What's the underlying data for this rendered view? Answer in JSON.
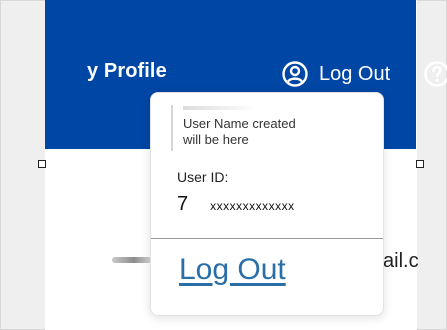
{
  "header": {
    "profile_label": "y Profile",
    "logout_label": "Log Out"
  },
  "background": {
    "email_fragment": "ail.c"
  },
  "dropdown": {
    "user_name_placeholder": "User Name created\nwill be here",
    "user_id_label": "User ID:",
    "user_id_prefix": "7",
    "user_id_masked": "xxxxxxxxxxxxx",
    "logout_link": "Log Out"
  },
  "colors": {
    "header_blue": "#0046a5",
    "link_blue": "#2a6ea8"
  },
  "icons": {
    "account": "user-circle-icon",
    "help": "question-circle-icon"
  }
}
